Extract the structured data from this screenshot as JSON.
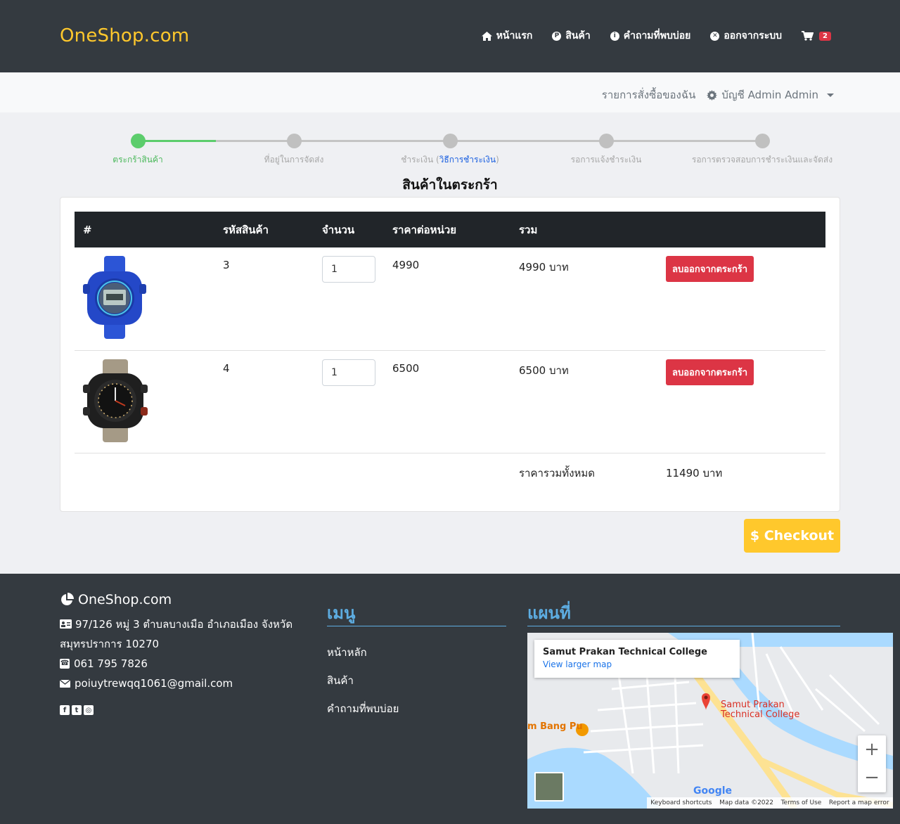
{
  "brand": "OneShop.com",
  "nav": {
    "home": "หน้าแรก",
    "products": "สินค้า",
    "faq": "คำถามที่พบบ่อย",
    "logout": "ออกจากระบบ",
    "cart_count": "2"
  },
  "subbar": {
    "orders": "รายการสั่งซื้อของฉัน",
    "account": "บัญชี Admin Admin"
  },
  "stepper": {
    "steps": [
      "ตระกร้าสินค้า",
      "ที่อยู่ในการจัดส่ง",
      "ชำระเงิน (",
      "รอการแจ้งชำระเงิน",
      "รอการตรวจสอบการชำระเงินและจัดส่ง"
    ],
    "payment_link": "วิธีการชำระเงิน",
    "payment_close": ")"
  },
  "section_title": "สินค้าในตระกร้า",
  "table": {
    "headers": [
      "#",
      "รหัสสินค้า",
      "จำนวน",
      "ราคาต่อหน่วย",
      "รวม"
    ],
    "rows": [
      {
        "code": "3",
        "qty": "1",
        "price": "4990",
        "total": "4990 บาท",
        "remove": "ลบออกจากตระกร้า"
      },
      {
        "code": "4",
        "qty": "1",
        "price": "6500",
        "total": "6500 บาท",
        "remove": "ลบออกจากตระกร้า"
      }
    ],
    "grand_label": "ราคารวมทั้งหมด",
    "grand_total": "11490 บาท"
  },
  "checkout": "$ Checkout",
  "footer": {
    "brand": "OneShop.com",
    "address": "97/126 หมู่ 3 ตำบลบางเมือ อำเภอเมือง จังหวัดสมุทรปราการ 10270",
    "phone": "061 795 7826",
    "email": "poiuytrewqq1061@gmail.com",
    "menu_title": "เมนู",
    "menu_items": [
      "หน้าหลัก",
      "สินค้า",
      "คำถามที่พบบ่อย"
    ],
    "map_title": "แผนที่",
    "map": {
      "place": "Samut Prakan Technical College",
      "larger": "View larger map",
      "pin_line1": "Samut Prakan",
      "pin_line2": "Technical College",
      "poi": "m Bang Pu",
      "google": "Google",
      "shortcuts": "Keyboard shortcuts",
      "mapdata": "Map data ©2022",
      "terms": "Terms of Use",
      "report": "Report a map error"
    }
  },
  "colors": {
    "brand": "#ffc82c",
    "navbar": "#343a40",
    "active_step": "#5ccd6c",
    "danger": "#dc3545",
    "footer_accent": "#5dade2"
  }
}
